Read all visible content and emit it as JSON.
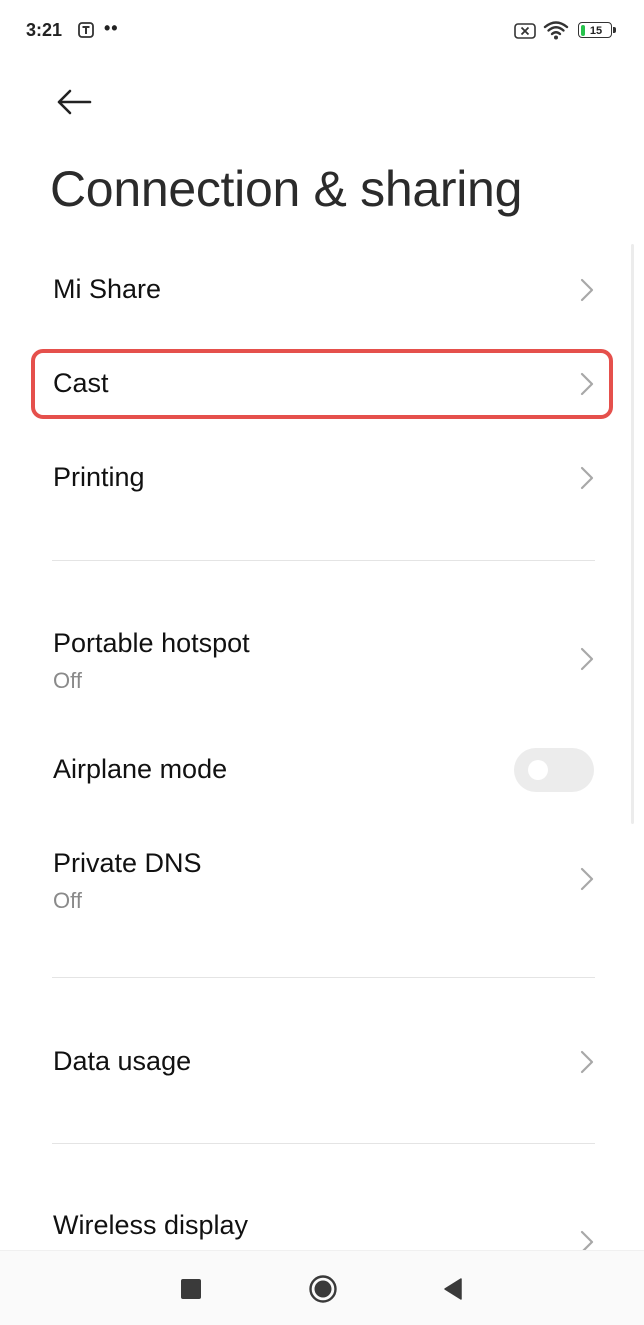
{
  "status_bar": {
    "time": "3:21",
    "dots": "••",
    "battery_level": "15",
    "battery_fraction": 0.15,
    "battery_color": "#27c24c",
    "icons": [
      "t-app-icon",
      "no-sim-icon",
      "wifi-icon",
      "battery-icon"
    ]
  },
  "header": {
    "back_icon": "back-arrow-icon",
    "title": "Connection & sharing"
  },
  "highlight_color": "#e5504c",
  "items": [
    {
      "label": "Mi Share",
      "type": "link"
    },
    {
      "label": "Cast",
      "type": "link",
      "highlighted": true
    },
    {
      "label": "Printing",
      "type": "link"
    },
    {
      "label": "Portable hotspot",
      "sub": "Off",
      "type": "link"
    },
    {
      "label": "Airplane mode",
      "type": "toggle",
      "on": false
    },
    {
      "label": "Private DNS",
      "sub": "Off",
      "type": "link"
    },
    {
      "label": "Data usage",
      "type": "link"
    },
    {
      "label": "Wireless display",
      "type": "link"
    }
  ],
  "nav_bar": {
    "icons": [
      "recents-icon",
      "home-icon",
      "back-icon"
    ]
  }
}
